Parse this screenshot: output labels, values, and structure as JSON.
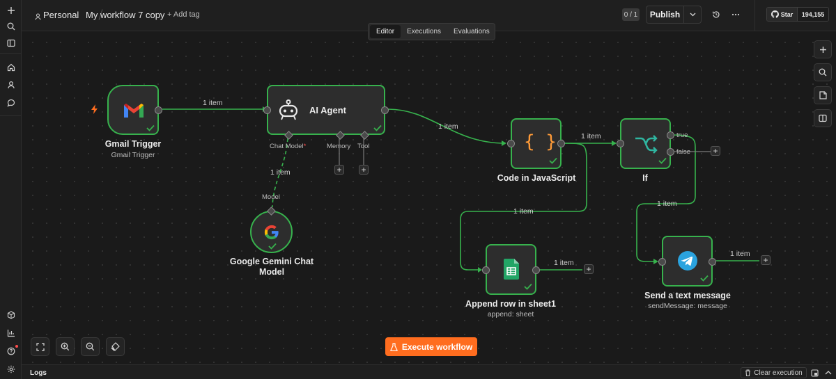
{
  "header": {
    "project": "Personal",
    "workflow_name": "My workflow 7 copy",
    "add_tag": "+ Add tag",
    "counter": "0 / 1",
    "publish": "Publish"
  },
  "github": {
    "star": "Star",
    "count": "194,155"
  },
  "tabs": [
    {
      "label": "Editor",
      "active": true
    },
    {
      "label": "Executions",
      "active": false
    },
    {
      "label": "Evaluations",
      "active": false
    }
  ],
  "nodes": {
    "gmail": {
      "title": "Gmail Trigger",
      "subtitle": "Gmail Trigger"
    },
    "agent": {
      "title": "AI Agent",
      "ports": {
        "chat_model": "Chat Model",
        "required_mark": "*",
        "memory": "Memory",
        "tool": "Tool"
      }
    },
    "gemini": {
      "title_line1": "Google Gemini Chat",
      "title_line2": "Model",
      "port": "Model"
    },
    "code": {
      "title": "Code in JavaScript"
    },
    "if": {
      "title": "If",
      "true_label": "true",
      "false_label": "false"
    },
    "sheets": {
      "title": "Append row in sheet1",
      "subtitle": "append: sheet"
    },
    "telegram": {
      "title": "Send a text message",
      "subtitle": "sendMessage: message"
    }
  },
  "edge_labels": {
    "gmail_agent": "1 item",
    "agent_code": "1 item",
    "model_agent": "1 item",
    "code_if": "1 item",
    "code_sheets": "1 item",
    "if_telegram": "1 item",
    "sheets_out": "1 item",
    "telegram_out": "1 item"
  },
  "execute": {
    "label": "Execute workflow"
  },
  "logs": {
    "label": "Logs",
    "clear": "Clear execution"
  },
  "colors": {
    "success": "#37b24d",
    "accent": "#ff6d1f",
    "canvas": "#1a1a1a",
    "node": "#2d2d2d"
  },
  "icons": {
    "rail": [
      "plus-icon",
      "search-icon",
      "sidebar-icon",
      "home-icon",
      "user-icon",
      "chat-icon",
      "cube-icon",
      "chart-icon",
      "help-icon",
      "settings-icon"
    ],
    "header": [
      "user-icon",
      "chevron-down-icon",
      "history-icon",
      "more-icon",
      "github-icon"
    ],
    "canvas_right": [
      "plus-icon",
      "search-icon",
      "sticky-note-icon",
      "panel-icon"
    ],
    "canvas_bottom": [
      "fit-view-icon",
      "zoom-in-icon",
      "zoom-out-icon",
      "tidy-up-icon"
    ]
  }
}
